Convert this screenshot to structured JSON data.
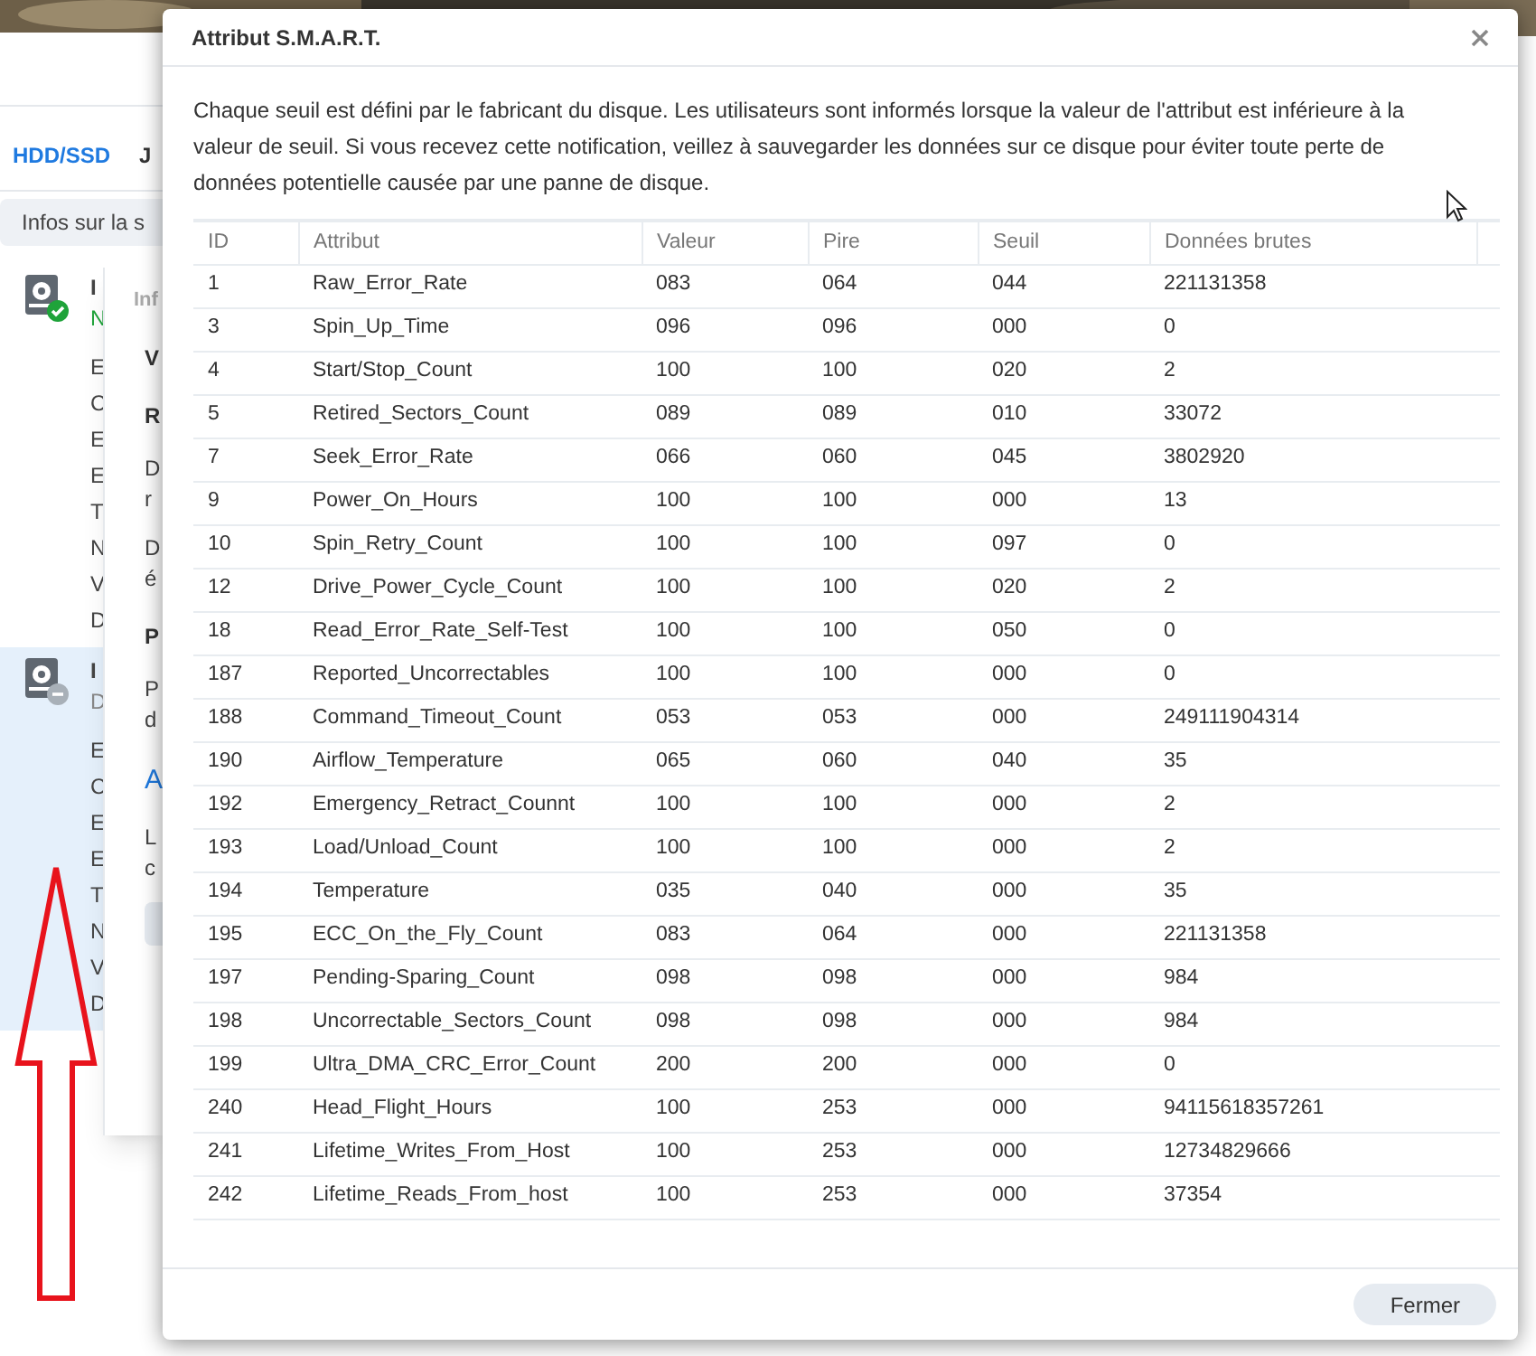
{
  "background_window": {
    "tabs": [
      {
        "label": "HDD/SSD",
        "selected": true
      },
      {
        "label": "J",
        "selected": false
      }
    ],
    "info_bar": "Infos sur la s",
    "disks": [
      {
        "kind": "healthy",
        "selected": false,
        "title": "I",
        "subtitle": "N",
        "lines": [
          "E",
          "C",
          "E",
          "E",
          "T",
          "N",
          "V",
          "D"
        ]
      },
      {
        "kind": "inactive",
        "selected": true,
        "title": "I",
        "subtitle": "D",
        "lines": [
          "E",
          "C",
          "E",
          "E",
          "T",
          "N",
          "V",
          "D"
        ]
      }
    ],
    "inner_dialog": {
      "title": "Inf",
      "blocks": [
        {
          "kind": "heading",
          "text": "V"
        },
        {
          "kind": "heading",
          "text": "R"
        },
        {
          "kind": "para",
          "lines": [
            "D",
            "r"
          ]
        },
        {
          "kind": "para",
          "lines": [
            "D",
            "é"
          ]
        },
        {
          "kind": "heading",
          "text": "P"
        },
        {
          "kind": "para",
          "lines": [
            "P",
            "d"
          ]
        },
        {
          "kind": "link",
          "text": "A"
        },
        {
          "kind": "para",
          "lines": [
            "L",
            "c"
          ]
        },
        {
          "kind": "button"
        }
      ]
    }
  },
  "dialog": {
    "title": "Attribut S.M.A.R.T.",
    "description": "Chaque seuil est défini par le fabricant du disque. Les utilisateurs sont informés lorsque la valeur de l'attribut est inférieure à la valeur de seuil. Si vous recevez cette notification, veillez à sauvegarder les données sur ce disque pour éviter toute perte de données potentielle causée par une panne de disque.",
    "table": {
      "columns": [
        "ID",
        "Attribut",
        "Valeur",
        "Pire",
        "Seuil",
        "Données brutes"
      ],
      "rows": [
        [
          "1",
          "Raw_Error_Rate",
          "083",
          "064",
          "044",
          "221131358"
        ],
        [
          "3",
          "Spin_Up_Time",
          "096",
          "096",
          "000",
          "0"
        ],
        [
          "4",
          "Start/Stop_Count",
          "100",
          "100",
          "020",
          "2"
        ],
        [
          "5",
          "Retired_Sectors_Count",
          "089",
          "089",
          "010",
          "33072"
        ],
        [
          "7",
          "Seek_Error_Rate",
          "066",
          "060",
          "045",
          "3802920"
        ],
        [
          "9",
          "Power_On_Hours",
          "100",
          "100",
          "000",
          "13"
        ],
        [
          "10",
          "Spin_Retry_Count",
          "100",
          "100",
          "097",
          "0"
        ],
        [
          "12",
          "Drive_Power_Cycle_Count",
          "100",
          "100",
          "020",
          "2"
        ],
        [
          "18",
          "Read_Error_Rate_Self-Test",
          "100",
          "100",
          "050",
          "0"
        ],
        [
          "187",
          "Reported_Uncorrectables",
          "100",
          "100",
          "000",
          "0"
        ],
        [
          "188",
          "Command_Timeout_Count",
          "053",
          "053",
          "000",
          "249111904314"
        ],
        [
          "190",
          "Airflow_Temperature",
          "065",
          "060",
          "040",
          "35"
        ],
        [
          "192",
          "Emergency_Retract_Counnt",
          "100",
          "100",
          "000",
          "2"
        ],
        [
          "193",
          "Load/Unload_Count",
          "100",
          "100",
          "000",
          "2"
        ],
        [
          "194",
          "Temperature",
          "035",
          "040",
          "000",
          "35"
        ],
        [
          "195",
          "ECC_On_the_Fly_Count",
          "083",
          "064",
          "000",
          "221131358"
        ],
        [
          "197",
          "Pending-Sparing_Count",
          "098",
          "098",
          "000",
          "984"
        ],
        [
          "198",
          "Uncorrectable_Sectors_Count",
          "098",
          "098",
          "000",
          "984"
        ],
        [
          "199",
          "Ultra_DMA_CRC_Error_Count",
          "200",
          "200",
          "000",
          "0"
        ],
        [
          "240",
          "Head_Flight_Hours",
          "100",
          "253",
          "000",
          "94115618357261"
        ],
        [
          "241",
          "Lifetime_Writes_From_Host",
          "100",
          "253",
          "000",
          "12734829666"
        ],
        [
          "242",
          "Lifetime_Reads_From_host",
          "100",
          "253",
          "000",
          "37354"
        ]
      ]
    },
    "close_button": "Fermer"
  }
}
